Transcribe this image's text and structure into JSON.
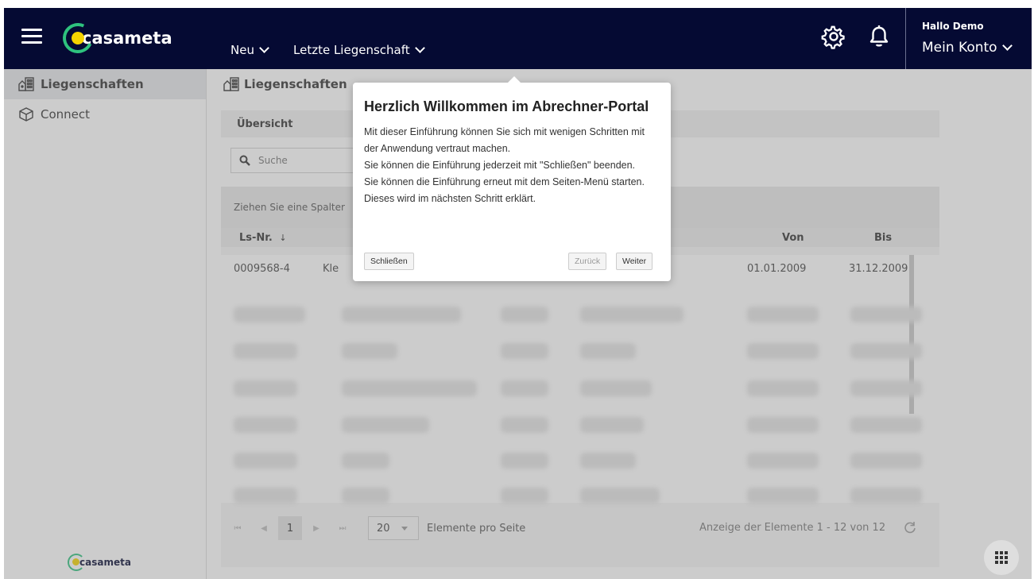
{
  "topbar": {
    "logo_text": "casameta",
    "nav": [
      {
        "label": "Neu"
      },
      {
        "label": "Letzte Liegenschaft"
      }
    ],
    "greeting": "Hallo Demo",
    "account_label": "Mein Konto"
  },
  "sidebar": {
    "items": [
      {
        "label": "Liegenschaften",
        "icon": "buildings-icon",
        "active": true
      },
      {
        "label": "Connect",
        "icon": "cube-icon",
        "active": false
      }
    ],
    "footer_logo_text": "casameta"
  },
  "main": {
    "header_title": "Liegenschaften",
    "card_title": "Übersicht",
    "search_placeholder": "Suche",
    "group_hint": "Ziehen Sie eine Spalter",
    "columns": {
      "nr": "Ls-Nr.",
      "nr_sort_icon": "↓",
      "von": "Von",
      "bis": "Bis"
    },
    "rows": [
      {
        "nr": "0009568-4",
        "name": "Kle",
        "von": "01.01.2009",
        "bis": "31.12.2009"
      }
    ],
    "pager": {
      "first": "⏮",
      "prev": "◀",
      "current_page": "1",
      "next": "▶",
      "last": "⏭",
      "page_size": "20",
      "page_size_label": "Elemente pro Seite",
      "info": "Anzeige der Elemente 1 - 12 von 12"
    }
  },
  "modal": {
    "title": "Herzlich Willkommen im Abrechner-Portal",
    "lines": [
      "Mit dieser Einführung können Sie sich mit wenigen Schritten mit der Anwendung vertraut machen.",
      "Sie können die Einführung jederzeit mit \"Schließen\" beenden.",
      "Sie können die Einführung erneut mit dem Seiten-Menü starten. Dieses wird im nächsten Schritt erklärt."
    ],
    "close_label": "Schließen",
    "back_label": "Zurück",
    "next_label": "Weiter"
  },
  "colors": {
    "topbar_bg": "#050a33",
    "brand_green": "#2ec27e",
    "brand_yellow": "#f5d300"
  }
}
